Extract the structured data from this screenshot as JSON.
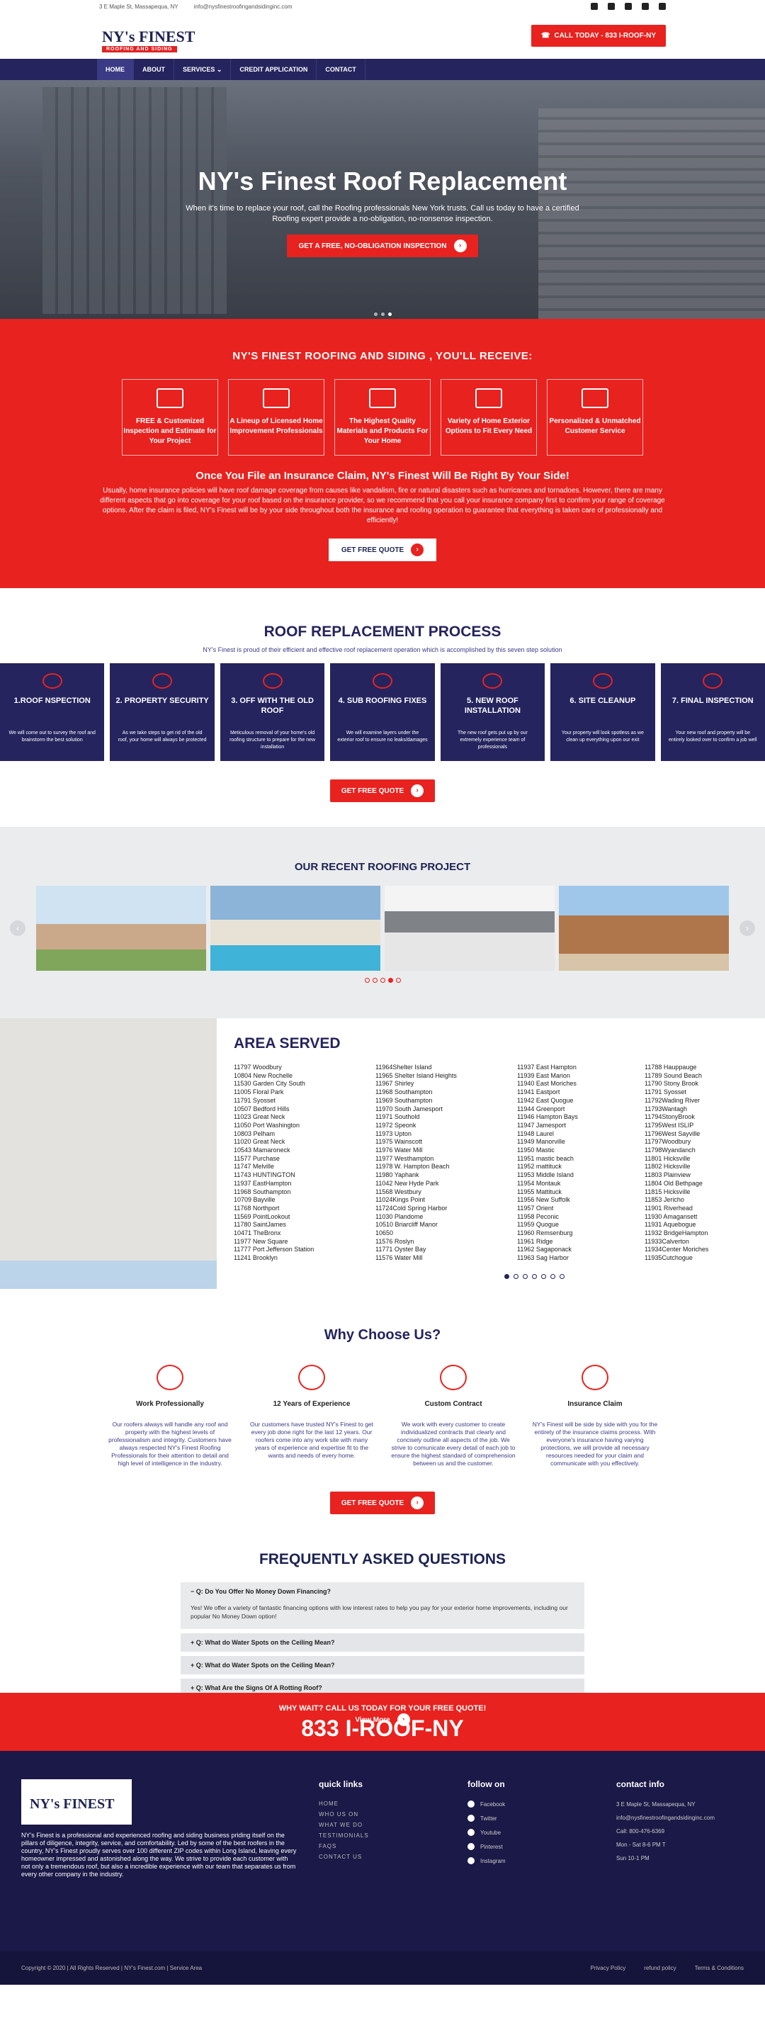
{
  "topbar": {
    "address": "3 E Maple St, Massapequa, NY",
    "email": "info@nysfinestroofingandsidinginc.com"
  },
  "header": {
    "logo": "NY's FINEST",
    "logo_sub": "ROOFING AND SIDING",
    "call": "CALL TODAY - 833 I-ROOF-NY"
  },
  "nav": [
    "HOME",
    "ABOUT",
    "SERVICES",
    "CREDIT APPLICATION",
    "CONTACT"
  ],
  "hero": {
    "title": "NY's Finest Roof Replacement",
    "text": "When it's time to replace your roof, call the Roofing professionals New York trusts. Call us today to have a certified Roofing expert provide a no-obligation, no-nonsense inspection.",
    "button": "GET A FREE, NO-OBLIGATION INSPECTION"
  },
  "receive": {
    "title": "NY'S FINEST ROOFING AND SIDING , YOU'LL RECEIVE:",
    "boxes": [
      "FREE & Customized Inspection and Estimate for Your Project",
      "A Lineup of Licensed Home Improvement Professionals",
      "The Highest Quality Materials and Products For Your Home",
      "Variety of Home Exterior Options to Fit Every Need",
      "Personalized & Unmatched Customer Service"
    ],
    "claim_title": "Once You File an Insurance Claim, NY's Finest Will Be Right By Your Side!",
    "claim_text": "Usually, home insurance policies will have roof damage coverage from causes like vandalism, fire or natural disasters such as hurricanes and tornadoes. However, there are many different aspects that go into coverage for your roof based on the insurance provider, so we recommend that you call your insurance company first to confirm your range of coverage options. After the claim is filed, NY's Finest will be by your side throughout both the insurance and roofing operation to guarantee that everything is taken care of professionally and efficiently!",
    "button": "GET FREE QUOTE"
  },
  "process": {
    "title": "ROOF REPLACEMENT PROCESS",
    "sub": "NY's Finest is proud of their efficient and effective roof replacement operation which is accomplished by this seven step solution",
    "steps": [
      {
        "n": "1.ROOF NSPECTION",
        "d": "We will come out to survey the roof and brainstorm the best solution"
      },
      {
        "n": "2. PROPERTY SECURITY",
        "d": "As we take steps to get rid of the old roof, your home will always be protected"
      },
      {
        "n": "3. OFF WITH THE OLD ROOF",
        "d": "Meticulous removal of your home's old roofing structure to prepare for the new installation"
      },
      {
        "n": "4. SUB ROOFING FIXES",
        "d": "We will examine layers under the exterior roof to ensure no leaks/damages"
      },
      {
        "n": "5. NEW ROOF INSTALLATION",
        "d": "The new roof gets put up by our extremely experience team of professionals"
      },
      {
        "n": "6. SITE CLEANUP",
        "d": "Your property will look spotless as we clean up everything upon our exit"
      },
      {
        "n": "7. FINAL INSPECTION",
        "d": "Your new roof and property will be entirely looked over to confirm a job well"
      }
    ],
    "button": "GET FREE QUOTE"
  },
  "projects": {
    "title": "OUR RECENT ROOFING PROJECT"
  },
  "area": {
    "title": "AREA SERVED",
    "col1": [
      "11797 Woodbury",
      "10804 New Rochelle",
      "11530 Garden City South",
      "11005 Floral Park",
      "11791 Syosset",
      "10507 Bedford Hills",
      "11023 Great Neck",
      "11050 Port Washington",
      "10803 Pelham",
      "11020 Great Neck",
      "10543 Mamaroneck",
      "11577 Purchase",
      "11747 Melville",
      "11743 HUNTINGTON",
      "11937 EastHampton",
      "11968 Southampton",
      "10709 Bayville",
      "11768 Northport",
      "11569 PointLookout",
      "11780 SaintJames",
      "10471 TheBronx",
      "11977 New Square",
      "11777 Port Jefferson Station",
      "11241 Brooklyn"
    ],
    "col2": [
      "11964Shelter Island",
      "11965 Shelter Island Heights",
      "11967 Shirley",
      "11968 Southampton",
      "11969 Southampton",
      "11970 South Jamesport",
      "11971 Southold",
      "11972 Speonk",
      "11973 Upton",
      "11975 Wainscott",
      "11976 Water Mill",
      "11977 Westhampton",
      "11978 W. Hampton Beach",
      "11980 Yaphank",
      "11042 New Hyde Park",
      "11568 Westbury",
      "11024Kings Point",
      "11724Cold Spring Harbor",
      "11030 Plandome",
      "10510 Briarcliff Manor",
      "10650",
      "11576 Roslyn",
      "11771 Oyster Bay",
      "11576 Water Mill"
    ],
    "col3": [
      "11937 East Hampton",
      "11939 East Marion",
      "11940 East Moriches",
      "11941 Eastport",
      "11942 East Quogue",
      "11944 Greenport",
      "11946 Hampton Bays",
      "11947 Jamesport",
      "11948 Laurel",
      "11949 Manorville",
      "11950 Mastic",
      "11951 mastic beach",
      "11952 mattituck",
      "11953 Middle Island",
      "11954 Montauk",
      "11955 Mattituck",
      "11956 New Suffolk",
      "11957 Orient",
      "11958 Peconic",
      "11959 Quogue",
      "11960 Remsenburg",
      "11961 Ridge",
      "11962 Sagaponack",
      "11963 Sag Harbor"
    ],
    "col4": [
      "11788 Hauppauge",
      "11789 Sound Beach",
      "11790 Stony Brook",
      "11791 Syosset",
      "11792Wading River",
      "11793Wantagh",
      "11794StonyBrook",
      "11795West ISLIP",
      "11796West Sayville",
      "11797Woodbury",
      "11798Wyandanch",
      "11801 Hicksville",
      "11802 Hicksville",
      "11803 Plainview",
      "11804 Old Bethpage",
      "11815 Hicksville",
      "11853 Jericho",
      "11901 Riverhead",
      "11930 Amagansett",
      "11931 Aquebogue",
      "11932 BridgeHampton",
      "11933Calverton",
      "11934Center Moriches",
      "11935Cutchogue"
    ]
  },
  "why": {
    "title": "Why Choose Us?",
    "items": [
      {
        "h": "Work Professionally",
        "p": "Our roofers always will handle any roof and property with the highest levels of professionalism and integrity. Customers have always respected NY's Finest Roofing Professionals for their attention to detail and high level of intelligence in the industry."
      },
      {
        "h": "12 Years of Experience",
        "p": "Our customers have trusted NY's Finest to get every job done right for the last 12 years. Our roofers come into any work site with many years of experience and expertise fit to the wants and needs of every home."
      },
      {
        "h": "Custom Contract",
        "p": "We work with every customer to create individualized contracts that clearly and concisely outline all aspects of the job. We strive to comunicate every detail of each job to ensure the highest standard of comprehension between us and the customer."
      },
      {
        "h": "Insurance Claim",
        "p": "NY's Finest will be side by side with you for the entirety of the insurance claims process. With everyone's insurance having varying protections, we will provide all necessary resources needed for your claim and communicate with you effectively."
      }
    ],
    "button": "GET FREE QUOTE"
  },
  "faq": {
    "title": "FREQUENTLY ASKED QUESTIONS",
    "q1": "Q: Do You Offer No Money Down Financing?",
    "a1": "Yes! We offer a variety of fantastic financing options with low interest rates to help you pay for your exterior home improvements, including our popular No Money Down option!",
    "q2": "Q: What do Water Spots on the Ceiling Mean?",
    "q3": "Q: What do Water Spots on the Ceiling Mean?",
    "q4": "Q: What Are the Signs Of A Rotting Roof?",
    "button": "View More"
  },
  "cta": {
    "small": "WHY WAIT? CALL US TODAY FOR YOUR FREE QUOTE!",
    "big": "833 I-ROOF-NY"
  },
  "footer": {
    "about": "NY's Finest is a professional and experienced roofing and siding business priding itself on the pillars of diligence, integrity, service, and comfortability. Led by some of the best roofers in the country, NY's Finest proudly serves over 100 different ZIP codes within Long Island, leaving every homeowner impressed and astonished along the way. We strive to provide each customer with not only a tremendous roof, but also a incredible experience with our team that separates us from every other company in the industry.",
    "ql_title": "quick links",
    "links": [
      "HOME",
      "WHO US ON",
      "WHAT WE DO",
      "TESTIMONIALS",
      "FAQS",
      "CONTACT US"
    ],
    "fu_title": "follow on",
    "social": [
      "Facebook",
      "Twitter",
      "Youtube",
      "Pinterest",
      "Instagram"
    ],
    "ci_title": "contact info",
    "addr": "3 E Maple St, Massapequa, NY",
    "email": "info@nysfinestroofingandsidinginc.com",
    "phone": "Call: 800-476-6369",
    "hours1": "Mon - Sat 8-6 PM T",
    "hours2": "Sun 10-1 PM",
    "copy": "Copyright © 2020 | All Rights Reserved | NY's Finest.com | Service Area",
    "privacy": "Privacy Policy",
    "refund": "refund policy",
    "terms": "Terms & Conditions"
  }
}
